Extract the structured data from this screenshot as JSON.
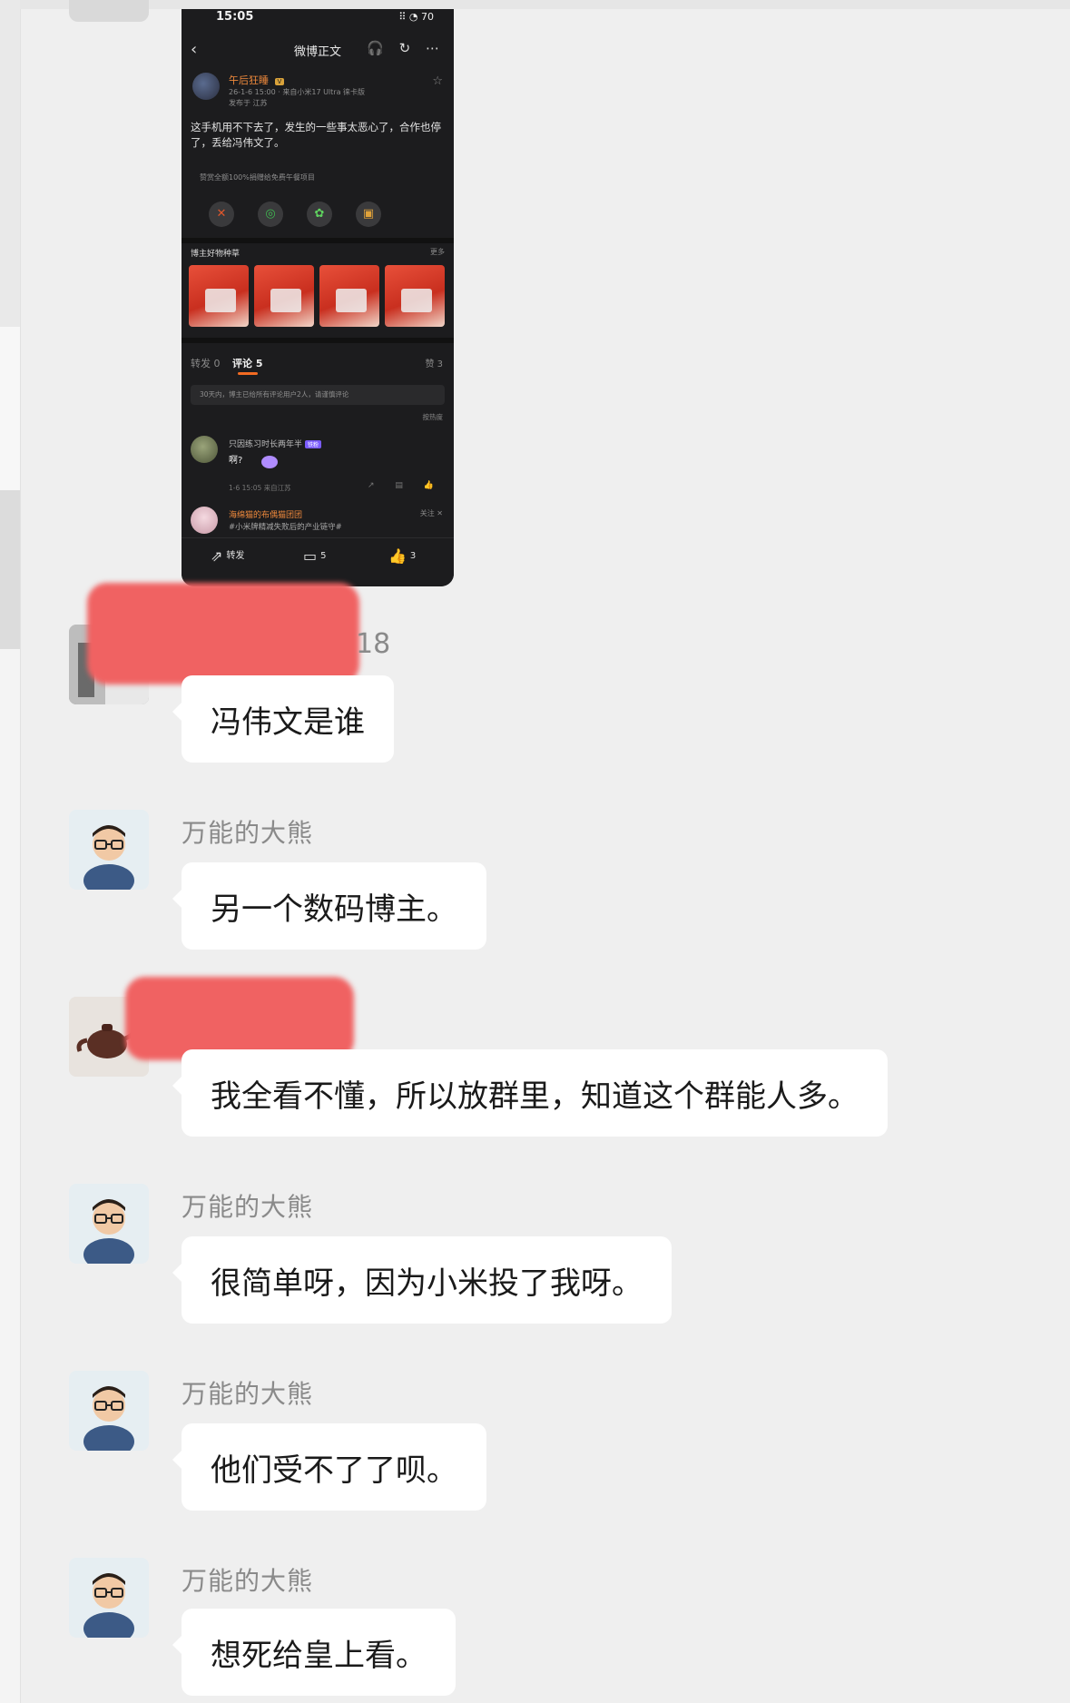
{
  "phone_screenshot": {
    "status_time": "15:05",
    "status_icons": "⠿ ◔ 70",
    "nav_back_icon": "‹",
    "nav_title": "微博正文",
    "nav_icons": "🎧 ↻ ⋯",
    "post": {
      "author": "午后狂睡",
      "author_badge": "V",
      "meta_line1": "26-1-6 15:00 · 来自小米17 Ultra 徕卡版",
      "meta_line2": "发布于 江苏",
      "text": "这手机用不下去了，发生的一些事太恶心了，合作也停了，丢给冯伟文了。",
      "mini_note": "赞赏全额100%捐赠给免费午餐项目",
      "share_icons": [
        "✕",
        "◎",
        "✿",
        "▣"
      ]
    },
    "shop": {
      "title": "博主好物种草",
      "more": "更多"
    },
    "tabs": [
      {
        "label": "转发 0"
      },
      {
        "label": "评论 5"
      }
    ],
    "likes_tab": "赞 3",
    "notice": "30天内，博主已给所有评论用户2人，请谨慎评论",
    "sort_label": "按热度",
    "comment": {
      "name": "只因练习时长两年半",
      "badge": "铁粉",
      "text": "啊?",
      "time": "1-6 15:05 来自江苏",
      "icons": "↗ ▤ 👍"
    },
    "reply": {
      "name": "海绵猫的布偶猫团团",
      "text": "#小米牌精减失败后的产业链守#",
      "follow": "关注 ✕"
    },
    "bottom_bar": {
      "repost": "转发",
      "comment": "5",
      "like": "3"
    }
  },
  "messages": [
    {
      "sender_tail": "18",
      "text": "冯伟文是谁"
    },
    {
      "sender": "万能的大熊",
      "text": "另一个数码博主。"
    },
    {
      "text": "我全看不懂，所以放群里，知道这个群能人多。"
    },
    {
      "sender": "万能的大熊",
      "text": "很简单呀，因为小米投了我呀。"
    },
    {
      "sender": "万能的大熊",
      "text": "他们受不了了呗。"
    },
    {
      "sender": "万能的大熊",
      "text": "想死给皇上看。"
    }
  ],
  "colors": {
    "background": "#efefef",
    "bubble": "#ffffff",
    "redaction": "#f06262",
    "phone_bg": "#1c1c1e",
    "accent_orange": "#f26b22"
  }
}
